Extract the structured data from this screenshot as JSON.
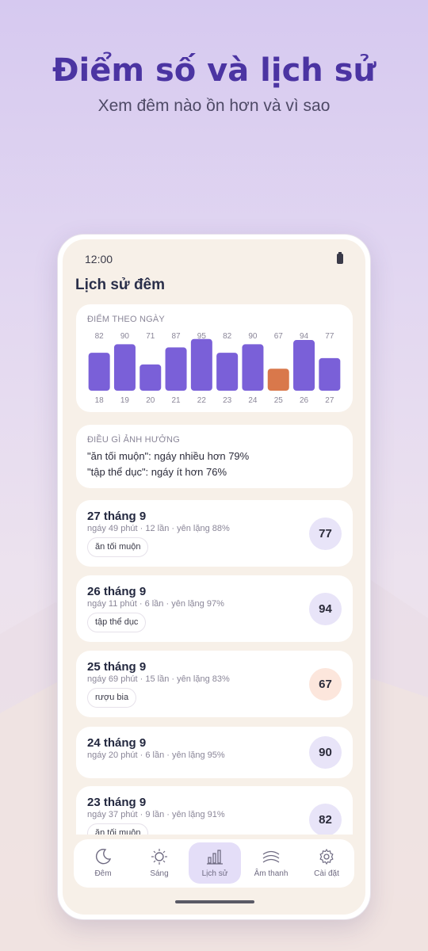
{
  "hero": {
    "title": "Điểm số và lịch sử",
    "subtitle": "Xem đêm nào ồn hơn và vì sao"
  },
  "status_bar": {
    "time": "12:00",
    "icon": "battery-icon"
  },
  "page": {
    "title": "Lịch sử đêm"
  },
  "colors": {
    "bar": "#7a60d8",
    "bar_highlight": "#d9784b",
    "accent": "#4b34a2"
  },
  "chart_data": {
    "type": "bar",
    "title": "ĐIỂM THEO NGÀY",
    "categories": [
      "18",
      "19",
      "20",
      "21",
      "22",
      "23",
      "24",
      "25",
      "26",
      "27"
    ],
    "values": [
      82,
      90,
      71,
      87,
      95,
      82,
      90,
      67,
      94,
      77
    ],
    "highlight": [
      "25"
    ],
    "grid": false
  },
  "insight": {
    "heading": "ĐIỀU GÌ ẢNH HƯỞNG",
    "lines": [
      "\"ăn tối muộn\": ngáy nhiều hơn 79%",
      "\"tập thể dục\": ngáy ít hơn 76%"
    ]
  },
  "nights": [
    {
      "date": "27 tháng 9",
      "meta": "ngáy 49 phút · 12 lần · yên lặng 88%",
      "tag": "ăn tối muộn",
      "score": "77"
    },
    {
      "date": "26 tháng 9",
      "meta": "ngáy 11 phút · 6 lần · yên lặng 97%",
      "tag": "tập thể dục",
      "score": "94"
    },
    {
      "date": "25 tháng 9",
      "meta": "ngáy 69 phút · 15 lần · yên lặng 83%",
      "tag": "rượu bia",
      "score": "67"
    },
    {
      "date": "24 tháng 9",
      "meta": "ngáy 20 phút · 6 lần · yên lặng 95%",
      "tag": "",
      "score": "90"
    },
    {
      "date": "23 tháng 9",
      "meta": "ngáy 37 phút · 9 lần · yên lặng 91%",
      "tag": "ăn tối muộn",
      "score": "82"
    }
  ],
  "nav": [
    {
      "label": "Đêm",
      "icon": "moon-icon",
      "active": false
    },
    {
      "label": "Sáng",
      "icon": "sun-icon",
      "active": false
    },
    {
      "label": "Lịch sử",
      "icon": "bar-chart-icon",
      "active": true
    },
    {
      "label": "Âm thanh",
      "icon": "waves-icon",
      "active": false
    },
    {
      "label": "Cài đặt",
      "icon": "gear-icon",
      "active": false
    }
  ]
}
